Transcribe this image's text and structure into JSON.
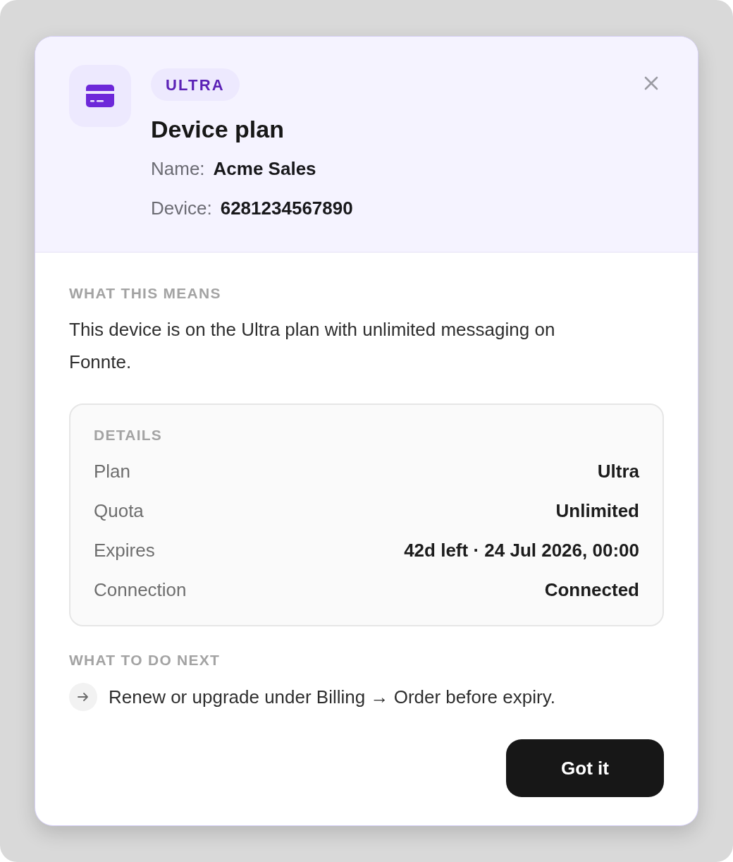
{
  "dialog": {
    "badge": "ULTRA",
    "title": "Device plan",
    "fields": [
      {
        "label": "Name:",
        "value": "Acme Sales"
      },
      {
        "label": "Device:",
        "value": "6281234567890"
      }
    ]
  },
  "meaning": {
    "heading": "WHAT THIS MEANS",
    "text": "This device is on the Ultra plan with unlimited messaging on Fonnte."
  },
  "details": {
    "heading": "DETAILS",
    "rows": [
      {
        "label": "Plan",
        "value": "Ultra"
      },
      {
        "label": "Quota",
        "value": "Unlimited"
      },
      {
        "label": "Expires",
        "value": "42d left · 24 Jul 2026, 00:00"
      },
      {
        "label": "Connection",
        "value": "Connected"
      }
    ]
  },
  "next_steps": {
    "heading": "WHAT TO DO NEXT",
    "items": [
      "Renew or upgrade under Billing → Order before expiry."
    ]
  },
  "buttons": [
    "Got it"
  ]
}
